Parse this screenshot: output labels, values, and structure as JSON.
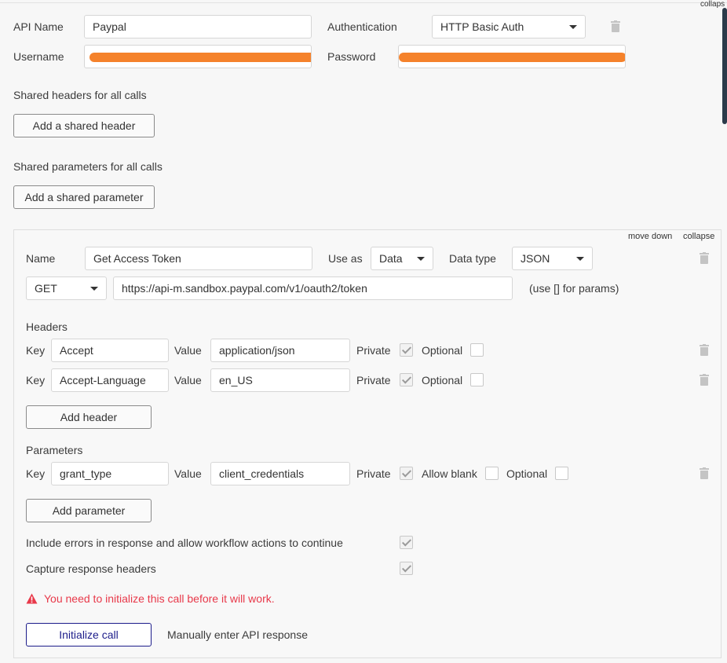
{
  "top_collapse": "collaps",
  "api": {
    "name_label": "API Name",
    "name_value": "Paypal",
    "auth_label": "Authentication",
    "auth_value": "HTTP Basic Auth",
    "username_label": "Username",
    "password_label": "Password"
  },
  "shared_headers": {
    "title": "Shared headers for all calls",
    "button": "Add a shared header"
  },
  "shared_params": {
    "title": "Shared parameters for all calls",
    "button": "Add a shared parameter"
  },
  "call": {
    "move_down": "move down",
    "collapse": "collapse",
    "name_label": "Name",
    "name_value": "Get Access Token",
    "use_as_label": "Use as",
    "use_as_value": "Data",
    "data_type_label": "Data type",
    "data_type_value": "JSON",
    "method": "GET",
    "url": "https://api-m.sandbox.paypal.com/v1/oauth2/token",
    "url_hint": "(use [] for params)",
    "headers_title": "Headers",
    "headers": [
      {
        "key_label": "Key",
        "key": "Accept",
        "value_label": "Value",
        "value": "application/json",
        "private_label": "Private",
        "private": true,
        "optional_label": "Optional",
        "optional": false
      },
      {
        "key_label": "Key",
        "key": "Accept-Language",
        "value_label": "Value",
        "value": "en_US",
        "private_label": "Private",
        "private": true,
        "optional_label": "Optional",
        "optional": false
      }
    ],
    "add_header": "Add header",
    "params_title": "Parameters",
    "params": [
      {
        "key_label": "Key",
        "key": "grant_type",
        "value_label": "Value",
        "value": "client_credentials",
        "private_label": "Private",
        "private": true,
        "allow_blank_label": "Allow blank",
        "allow_blank": false,
        "optional_label": "Optional",
        "optional": false
      }
    ],
    "add_param": "Add parameter",
    "include_errors_label": "Include errors in response and allow workflow actions to continue",
    "include_errors": true,
    "capture_headers_label": "Capture response headers",
    "capture_headers": true,
    "warning": "You need to initialize this call before it will work.",
    "init_button": "Initialize call",
    "manual_entry": "Manually enter API response"
  },
  "colors": {
    "warning": "#e8394a",
    "primary_border": "#1c1c8a",
    "redaction": "#f47b20"
  }
}
